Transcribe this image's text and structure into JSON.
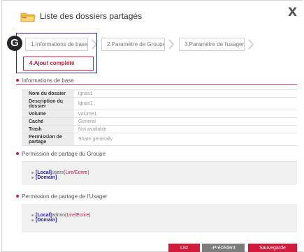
{
  "dialog": {
    "title": "Liste des dossiers partagés",
    "close_label": "X"
  },
  "wizard": {
    "badge": "G",
    "steps": [
      {
        "label": "1.Informations de base"
      },
      {
        "label": "2.Paramètre de Groupe"
      },
      {
        "label": "3.Paramètre de l'usager"
      },
      {
        "label": "4.Ajout complété"
      }
    ]
  },
  "basic_info": {
    "section_title": "Informations de base",
    "rows": [
      {
        "label": "Nom du dossier",
        "value": "lgnas1"
      },
      {
        "label": "Description du dossier",
        "value": "lgnas1"
      },
      {
        "label": "Volume",
        "value": "volume1"
      },
      {
        "label": "Caché",
        "value": "General"
      },
      {
        "label": "Trash",
        "value": "Not available"
      },
      {
        "label": "Permission de partage",
        "value": "Share generally"
      }
    ]
  },
  "group_permission": {
    "section_title": "Permission de partage du Groupe",
    "entries": [
      {
        "tag": "[Local]",
        "name": "users",
        "open": "(",
        "rights": "Lire/Ecrire",
        "close": ")"
      },
      {
        "tag": "[Domain]",
        "name": "",
        "open": "",
        "rights": "",
        "close": ""
      }
    ]
  },
  "user_permission": {
    "section_title": "Permission de partage de l'Usager",
    "entries": [
      {
        "tag": "[Local]",
        "name": "admin",
        "open": "(",
        "rights": "Lire/Ecrire",
        "close": ")"
      },
      {
        "tag": "[Domain]",
        "name": "",
        "open": "",
        "rights": "",
        "close": ""
      }
    ]
  },
  "footer": {
    "list_label": "List",
    "prev_label": "‹Précédent",
    "save_label": "Sauvegarde"
  },
  "colors": {
    "accent": "#d21b3c",
    "highlight_border": "#2a2aa0",
    "badge_bg": "#26262a",
    "secondary_button": "#7c7c7c",
    "domain_tag": "#1f1fa6"
  }
}
